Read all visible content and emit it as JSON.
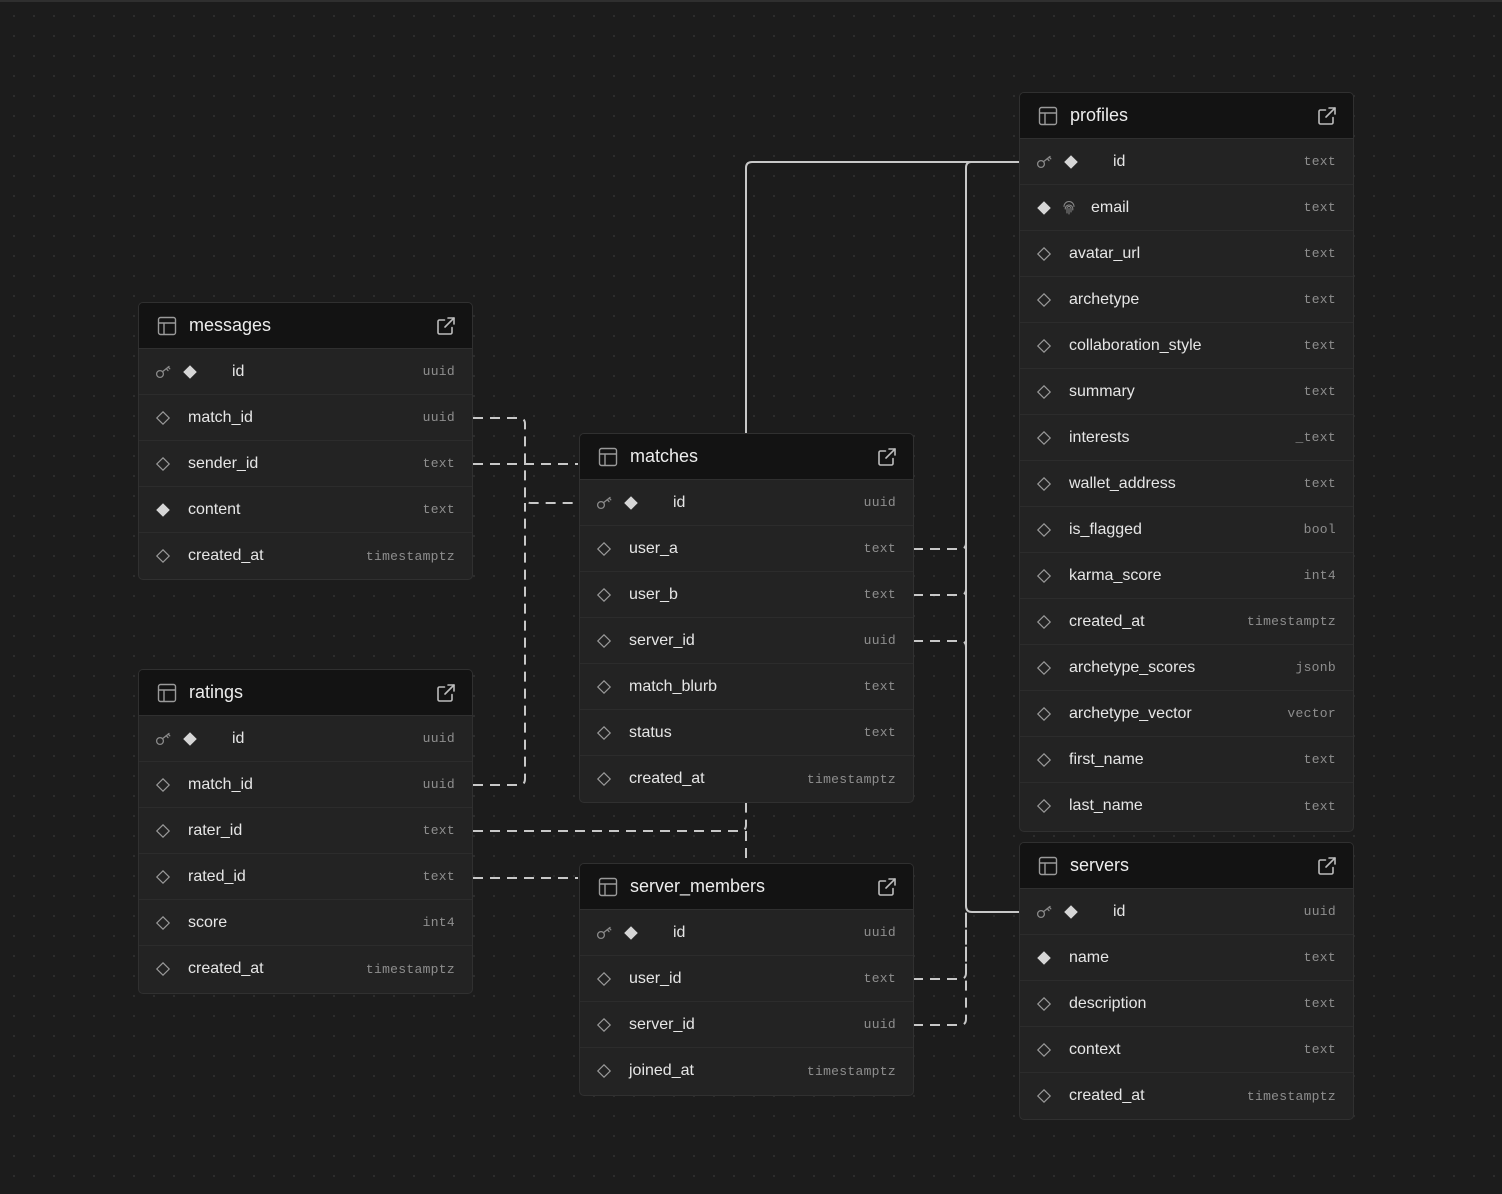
{
  "tables": [
    {
      "key": "messages",
      "name": "messages",
      "columns": [
        {
          "name": "id",
          "type": "uuid",
          "kind": "pk"
        },
        {
          "name": "match_id",
          "type": "uuid",
          "kind": "nullable"
        },
        {
          "name": "sender_id",
          "type": "text",
          "kind": "nullable"
        },
        {
          "name": "content",
          "type": "text",
          "kind": "not-null"
        },
        {
          "name": "created_at",
          "type": "timestamptz",
          "kind": "nullable"
        }
      ]
    },
    {
      "key": "ratings",
      "name": "ratings",
      "columns": [
        {
          "name": "id",
          "type": "uuid",
          "kind": "pk"
        },
        {
          "name": "match_id",
          "type": "uuid",
          "kind": "nullable"
        },
        {
          "name": "rater_id",
          "type": "text",
          "kind": "nullable"
        },
        {
          "name": "rated_id",
          "type": "text",
          "kind": "nullable"
        },
        {
          "name": "score",
          "type": "int4",
          "kind": "nullable"
        },
        {
          "name": "created_at",
          "type": "timestamptz",
          "kind": "nullable"
        }
      ]
    },
    {
      "key": "matches",
      "name": "matches",
      "columns": [
        {
          "name": "id",
          "type": "uuid",
          "kind": "pk"
        },
        {
          "name": "user_a",
          "type": "text",
          "kind": "nullable"
        },
        {
          "name": "user_b",
          "type": "text",
          "kind": "nullable"
        },
        {
          "name": "server_id",
          "type": "uuid",
          "kind": "nullable"
        },
        {
          "name": "match_blurb",
          "type": "text",
          "kind": "nullable"
        },
        {
          "name": "status",
          "type": "text",
          "kind": "nullable"
        },
        {
          "name": "created_at",
          "type": "timestamptz",
          "kind": "nullable"
        }
      ]
    },
    {
      "key": "server_members",
      "name": "server_members",
      "columns": [
        {
          "name": "id",
          "type": "uuid",
          "kind": "pk"
        },
        {
          "name": "user_id",
          "type": "text",
          "kind": "nullable"
        },
        {
          "name": "server_id",
          "type": "uuid",
          "kind": "nullable"
        },
        {
          "name": "joined_at",
          "type": "timestamptz",
          "kind": "nullable"
        }
      ]
    },
    {
      "key": "profiles",
      "name": "profiles",
      "columns": [
        {
          "name": "id",
          "type": "text",
          "kind": "pk"
        },
        {
          "name": "email",
          "type": "text",
          "kind": "unique-not-null"
        },
        {
          "name": "avatar_url",
          "type": "text",
          "kind": "nullable"
        },
        {
          "name": "archetype",
          "type": "text",
          "kind": "nullable"
        },
        {
          "name": "collaboration_style",
          "type": "text",
          "kind": "nullable"
        },
        {
          "name": "summary",
          "type": "text",
          "kind": "nullable"
        },
        {
          "name": "interests",
          "type": "_text",
          "kind": "nullable"
        },
        {
          "name": "wallet_address",
          "type": "text",
          "kind": "nullable"
        },
        {
          "name": "is_flagged",
          "type": "bool",
          "kind": "nullable"
        },
        {
          "name": "karma_score",
          "type": "int4",
          "kind": "nullable"
        },
        {
          "name": "created_at",
          "type": "timestamptz",
          "kind": "nullable"
        },
        {
          "name": "archetype_scores",
          "type": "jsonb",
          "kind": "nullable"
        },
        {
          "name": "archetype_vector",
          "type": "vector",
          "kind": "nullable"
        },
        {
          "name": "first_name",
          "type": "text",
          "kind": "nullable"
        },
        {
          "name": "last_name",
          "type": "text",
          "kind": "nullable"
        }
      ]
    },
    {
      "key": "servers",
      "name": "servers",
      "columns": [
        {
          "name": "id",
          "type": "uuid",
          "kind": "pk"
        },
        {
          "name": "name",
          "type": "text",
          "kind": "not-null"
        },
        {
          "name": "description",
          "type": "text",
          "kind": "nullable"
        },
        {
          "name": "context",
          "type": "text",
          "kind": "nullable"
        },
        {
          "name": "created_at",
          "type": "timestamptz",
          "kind": "nullable"
        }
      ]
    }
  ],
  "icons": {
    "table": "table-icon",
    "open": "external-link-icon",
    "primary_key": "key-icon",
    "not_null": "filled-diamond-icon",
    "nullable": "outline-diamond-icon",
    "unique": "fingerprint-icon"
  },
  "colors": {
    "canvas": "#1c1c1c",
    "table_body": "#232323",
    "table_header": "#131313",
    "edge": "#c8c8c8"
  }
}
